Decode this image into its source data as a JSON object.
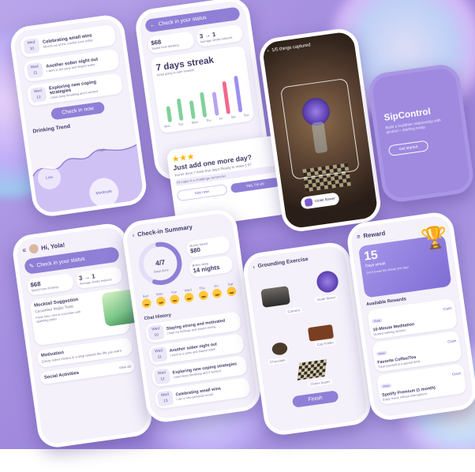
{
  "app": {
    "name": "SipControl",
    "tagline": "Build a healthier relationship with alcohol – starting today.",
    "get_started": "Get started"
  },
  "history": {
    "items": [
      {
        "day": "Wed",
        "num": "10",
        "title": "Celebrating small wins",
        "sub": "Moved out of the comfort zone today"
      },
      {
        "day": "Wed",
        "num": "11",
        "title": "Another sober night out",
        "sub": "I went to the party and stayed sober"
      },
      {
        "day": "Wed",
        "num": "12",
        "title": "Exploring new coping strategies",
        "sub": "I tried deep breathing and it worked"
      }
    ],
    "check_in_now": "Check in now",
    "drinking_trend": "Drinking Trend",
    "tag_high": "High",
    "tag_moderate": "Moderate",
    "tag_low": "Low"
  },
  "streak": {
    "check_in": "Check in your status",
    "saved": "$68",
    "saved_sub": "Saved from drinking",
    "avg": "3 → 1",
    "avg_sub": "Average drinks reduced",
    "title": "7 days streak",
    "title_sub": "Keep going to earn rewards",
    "bars": [
      38,
      52,
      44,
      60,
      56,
      78,
      88
    ],
    "bar_colors": [
      "#7fd19a",
      "#7fd19a",
      "#7fd19a",
      "#7fd19a",
      "#b9a3f0",
      "#f06a8a",
      "#9c8ff0"
    ],
    "days": [
      "Mon",
      "Tue",
      "Wed",
      "Thu",
      "Fri",
      "Sat",
      "Sun"
    ]
  },
  "popup": {
    "title": "Just add one more day?",
    "body": "You've done 7 drink-free days! Ready to make it 8?",
    "hint": "I'll make it a challenge tomorrow",
    "cancel": "Not now",
    "confirm": "Yes, I'm in!"
  },
  "camera": {
    "title": "1/5 things captured",
    "object": "Violet flower"
  },
  "home": {
    "greeting": "Hi, Yola!",
    "check_in": "Check in your status",
    "saved": "$68",
    "saved_sub": "Saved from drinking",
    "avg": "3 → 1",
    "avg_sub": "Average drinks reduced",
    "mocktail_title": "Mocktail Suggestion",
    "mocktail_name": "Cucumber Mojito Twist",
    "mocktail_sub": "Fresh lime, mint & cucumber with sparkling water",
    "motivation_title": "Motivation",
    "motivation_text": "Every sober choice is a step toward the life you want",
    "social_title": "Social Activities",
    "social_view": "View all"
  },
  "summary": {
    "title": "Check-in Summary",
    "progress": "4/7",
    "progress_label": "Days done",
    "progress_fraction": 0.57,
    "money": "$80",
    "money_label": "Money saved",
    "sleep": "14 nights",
    "sleep_label": "Better sleep",
    "days": [
      "Sun",
      "Mon",
      "Tue",
      "Wed",
      "Thu",
      "Fri",
      "Sat"
    ],
    "chat_title": "Chat History",
    "chats": [
      {
        "day": "Wed",
        "num": "10",
        "title": "Staying strong and motivated",
        "sub": "I kept my feelings and stayed strong"
      },
      {
        "day": "Wed",
        "num": "11",
        "title": "Another sober night out",
        "sub": "I went to a party and stayed sober"
      },
      {
        "day": "Wed",
        "num": "12",
        "title": "Exploring new coping strategies",
        "sub": "I tried deep breathing and it worked"
      },
      {
        "day": "Wed",
        "num": "13",
        "title": "Celebrating small wins",
        "sub": "I ran a new personal record"
      }
    ]
  },
  "grounding": {
    "title": "Grounding Exercise",
    "items": [
      "Camera",
      "Violet flower",
      "Cup holder",
      "Chocolate",
      "Chess board"
    ],
    "finish": "Finish"
  },
  "reward": {
    "title": "Reward",
    "streak": "15",
    "streak_sub": "Days streak",
    "streak_note": "Don't break the streak one day!",
    "available": "Available Rewards",
    "items": [
      {
        "tag": "Free",
        "title": "10-Minute Meditation",
        "sub": "Guided calming session"
      },
      {
        "tag": "Free",
        "title": "Favorite Coffee/Tea",
        "sub": "Treat yourself to a special drink"
      },
      {
        "tag": "Free",
        "title": "Spotify Premium (1 month)",
        "sub": "Enjoy music without interruptions"
      }
    ],
    "claim": "Claim"
  },
  "colors": {
    "accent": "#8f7fd6",
    "accent_dark": "#6c5cc8",
    "card": "#ffffff",
    "bg": "#f4f1fb"
  }
}
